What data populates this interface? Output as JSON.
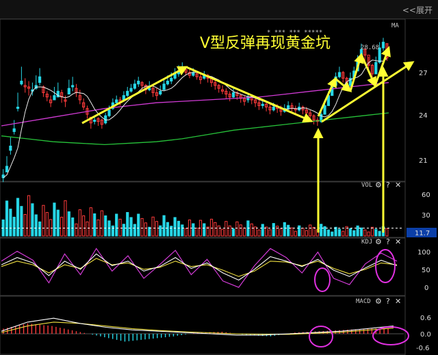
{
  "toolbar": {
    "expand_label": "<<展开"
  },
  "annotation": {
    "title": "V型反弹再现黄金坑"
  },
  "price_panel": {
    "label_ma": "MA",
    "price_label": "28.68",
    "stars": "*   ***   *** *****",
    "ticks": [
      "27",
      "24",
      "21"
    ]
  },
  "vol_panel": {
    "label": "VOL",
    "ticks": [
      "60",
      "30"
    ],
    "current": "11.7"
  },
  "kdj_panel": {
    "label": "KDJ",
    "ticks": [
      "100",
      "50",
      "0"
    ]
  },
  "macd_panel": {
    "label": "MACD",
    "ticks": [
      "0.6",
      "0.0",
      "-0.6"
    ]
  },
  "controls": {
    "gear": "⚙",
    "help": "?",
    "close": "✕"
  },
  "colors": {
    "up": "#ff3b3b",
    "down": "#27d6e6",
    "ma_purple": "#d23bd6",
    "ma_green": "#27c33a",
    "arrow": "#ffff33",
    "circle": "#e030e0"
  },
  "chart_data": {
    "type": "candlestick",
    "price_range": [
      19.5,
      30.5
    ],
    "candles": [
      [
        19.8,
        20.2,
        19.3,
        19.6
      ],
      [
        20.4,
        21.1,
        20.0,
        20.0
      ],
      [
        21.8,
        22.4,
        21.2,
        21.5
      ],
      [
        23.0,
        23.6,
        22.6,
        22.8
      ],
      [
        24.5,
        25.5,
        24.2,
        24.4
      ],
      [
        26.3,
        27.3,
        26.0,
        26.1
      ],
      [
        25.9,
        26.5,
        25.5,
        26.0
      ],
      [
        25.8,
        26.3,
        25.3,
        25.9
      ],
      [
        25.7,
        26.2,
        25.3,
        25.6
      ],
      [
        26.0,
        26.7,
        25.7,
        25.8
      ],
      [
        26.6,
        27.2,
        26.0,
        26.2
      ],
      [
        25.5,
        26.0,
        25.2,
        25.9
      ],
      [
        25.2,
        25.6,
        24.9,
        25.4
      ],
      [
        24.8,
        25.3,
        24.5,
        25.0
      ],
      [
        25.3,
        25.9,
        25.0,
        25.0
      ],
      [
        25.6,
        26.2,
        25.2,
        25.2
      ],
      [
        25.2,
        25.7,
        24.8,
        25.5
      ],
      [
        24.9,
        25.3,
        24.5,
        25.0
      ],
      [
        25.8,
        26.4,
        25.4,
        25.4
      ],
      [
        26.0,
        26.6,
        25.6,
        25.9
      ],
      [
        25.5,
        26.1,
        25.2,
        25.8
      ],
      [
        25.0,
        25.7,
        24.7,
        25.3
      ],
      [
        24.5,
        25.1,
        24.3,
        24.8
      ],
      [
        24.0,
        24.6,
        23.7,
        24.4
      ],
      [
        23.4,
        23.8,
        23.0,
        23.8
      ],
      [
        23.6,
        23.9,
        23.3,
        23.5
      ],
      [
        23.5,
        23.8,
        23.2,
        23.7
      ],
      [
        23.3,
        23.7,
        23.0,
        23.6
      ],
      [
        23.9,
        24.1,
        23.3,
        23.4
      ],
      [
        24.3,
        24.6,
        23.8,
        23.9
      ],
      [
        24.8,
        25.1,
        24.3,
        24.4
      ],
      [
        25.0,
        25.3,
        24.6,
        24.8
      ],
      [
        24.8,
        25.2,
        24.6,
        25.0
      ],
      [
        25.3,
        25.6,
        24.9,
        25.0
      ],
      [
        25.6,
        25.9,
        25.2,
        25.3
      ],
      [
        25.8,
        26.1,
        25.5,
        25.6
      ],
      [
        26.1,
        26.4,
        25.7,
        25.8
      ],
      [
        26.3,
        26.6,
        25.9,
        26.1
      ],
      [
        26.0,
        26.3,
        25.6,
        26.2
      ],
      [
        25.7,
        26.1,
        25.4,
        26.0
      ],
      [
        25.8,
        26.3,
        25.6,
        25.7
      ],
      [
        25.5,
        26.1,
        25.2,
        25.8
      ],
      [
        25.3,
        25.8,
        25.0,
        25.5
      ],
      [
        25.6,
        26.0,
        25.3,
        25.4
      ],
      [
        26.1,
        26.5,
        25.7,
        25.7
      ],
      [
        26.3,
        26.7,
        26.0,
        26.1
      ],
      [
        26.5,
        26.9,
        26.1,
        26.3
      ],
      [
        26.8,
        27.2,
        26.4,
        26.5
      ],
      [
        27.0,
        27.4,
        26.6,
        26.8
      ],
      [
        27.2,
        27.6,
        26.9,
        27.0
      ],
      [
        26.9,
        27.3,
        26.7,
        27.1
      ],
      [
        26.7,
        27.1,
        26.5,
        26.9
      ],
      [
        26.9,
        27.2,
        26.6,
        26.7
      ],
      [
        26.6,
        27.0,
        26.4,
        26.8
      ],
      [
        26.4,
        26.8,
        26.1,
        26.6
      ],
      [
        26.7,
        27.0,
        26.4,
        26.5
      ],
      [
        26.5,
        26.8,
        26.2,
        26.7
      ],
      [
        26.2,
        26.6,
        25.9,
        26.5
      ],
      [
        26.0,
        26.4,
        25.7,
        26.2
      ],
      [
        25.8,
        26.1,
        25.5,
        26.0
      ],
      [
        25.6,
        26.0,
        25.4,
        25.7
      ],
      [
        25.4,
        25.8,
        25.1,
        25.6
      ],
      [
        25.2,
        25.6,
        24.9,
        25.4
      ],
      [
        25.5,
        25.8,
        25.1,
        25.2
      ],
      [
        25.3,
        25.6,
        25.0,
        25.5
      ],
      [
        25.1,
        25.4,
        24.8,
        25.3
      ],
      [
        24.9,
        25.3,
        24.6,
        25.1
      ],
      [
        25.2,
        25.5,
        24.8,
        25.0
      ],
      [
        25.0,
        25.3,
        24.7,
        25.2
      ],
      [
        24.8,
        25.1,
        24.5,
        25.0
      ],
      [
        24.6,
        25.0,
        24.3,
        24.8
      ],
      [
        24.7,
        25.0,
        24.4,
        24.6
      ],
      [
        24.5,
        24.8,
        24.2,
        24.7
      ],
      [
        24.3,
        24.7,
        24.0,
        24.5
      ],
      [
        24.5,
        24.8,
        24.2,
        24.3
      ],
      [
        24.4,
        24.7,
        24.1,
        24.5
      ],
      [
        24.2,
        24.6,
        23.9,
        24.4
      ],
      [
        24.4,
        24.7,
        24.1,
        24.2
      ],
      [
        24.6,
        24.9,
        24.3,
        24.4
      ],
      [
        24.4,
        24.8,
        24.2,
        24.6
      ],
      [
        24.3,
        24.6,
        24.0,
        24.4
      ],
      [
        24.5,
        24.8,
        24.2,
        24.3
      ],
      [
        24.3,
        24.6,
        24.0,
        24.5
      ],
      [
        24.1,
        24.5,
        23.8,
        24.3
      ],
      [
        23.9,
        24.3,
        23.6,
        24.1
      ],
      [
        23.6,
        24.0,
        23.3,
        23.9
      ],
      [
        23.5,
        23.8,
        23.2,
        23.6
      ],
      [
        24.0,
        24.3,
        23.4,
        23.5
      ],
      [
        24.6,
        25.0,
        24.0,
        24.0
      ],
      [
        25.3,
        25.6,
        24.6,
        24.6
      ],
      [
        26.0,
        26.3,
        25.3,
        25.3
      ],
      [
        26.6,
        26.9,
        25.9,
        26.0
      ],
      [
        26.9,
        27.3,
        26.5,
        26.6
      ],
      [
        26.5,
        27.0,
        26.2,
        26.9
      ],
      [
        26.0,
        26.6,
        25.8,
        26.5
      ],
      [
        26.5,
        26.9,
        25.9,
        26.0
      ],
      [
        27.0,
        27.3,
        26.4,
        26.5
      ],
      [
        27.8,
        28.1,
        27.0,
        27.0
      ],
      [
        28.5,
        28.9,
        27.7,
        27.8
      ],
      [
        28.1,
        28.6,
        27.6,
        28.5
      ],
      [
        27.4,
        28.0,
        27.1,
        28.1
      ],
      [
        26.8,
        27.5,
        26.5,
        27.4
      ],
      [
        27.6,
        28.0,
        26.8,
        26.8
      ],
      [
        28.6,
        29.0,
        27.5,
        27.6
      ],
      [
        29.0,
        29.3,
        28.4,
        28.6
      ],
      [
        27.9,
        28.9,
        27.7,
        28.9
      ]
    ],
    "ma_purple": [
      23.2,
      23.5,
      23.8,
      24.1,
      24.4,
      24.6,
      24.8,
      24.9,
      25.0,
      25.1,
      25.2,
      25.4,
      25.6,
      25.8,
      26.0,
      26.2
    ],
    "ma_green": [
      22.5,
      22.3,
      22.1,
      22.0,
      21.9,
      22.0,
      22.1,
      22.3,
      22.6,
      22.9,
      23.1,
      23.3,
      23.5,
      23.7,
      23.9,
      24.1
    ],
    "vol": [
      48,
      42,
      36,
      30,
      26,
      22,
      20,
      18,
      16,
      14,
      12,
      12
    ],
    "vol_reference": 11.7,
    "kdj_k": [
      62,
      78,
      66,
      38,
      70,
      52,
      86,
      60,
      70,
      48,
      58,
      78,
      54,
      66,
      44,
      28,
      52,
      80,
      70,
      58,
      74,
      50,
      36,
      55,
      72,
      60
    ],
    "kdj_d": [
      58,
      70,
      62,
      44,
      62,
      54,
      76,
      62,
      66,
      52,
      56,
      70,
      58,
      62,
      50,
      36,
      48,
      70,
      68,
      60,
      70,
      54,
      42,
      52,
      66,
      62
    ],
    "kdj_j": [
      70,
      92,
      72,
      22,
      86,
      40,
      98,
      48,
      82,
      32,
      62,
      94,
      40,
      74,
      26,
      12,
      60,
      98,
      78,
      44,
      90,
      32,
      18,
      64,
      88,
      70
    ],
    "macd_dif": [
      0.1,
      0.45,
      0.6,
      0.4,
      0.25,
      0.15,
      0.1,
      0.05,
      0.0,
      -0.05,
      -0.05,
      0.0,
      0.05,
      0.1,
      0.2,
      0.3
    ],
    "macd_dea": [
      0.05,
      0.3,
      0.45,
      0.4,
      0.3,
      0.2,
      0.13,
      0.08,
      0.04,
      0.0,
      -0.02,
      -0.02,
      0.02,
      0.06,
      0.14,
      0.22
    ],
    "macd_hist": [
      0.2,
      0.4,
      0.3,
      0.1,
      -0.1,
      -0.3,
      -0.2,
      -0.1,
      0.05,
      0.08,
      -0.05,
      -0.1,
      0.05,
      0.1,
      0.15,
      0.2
    ]
  }
}
